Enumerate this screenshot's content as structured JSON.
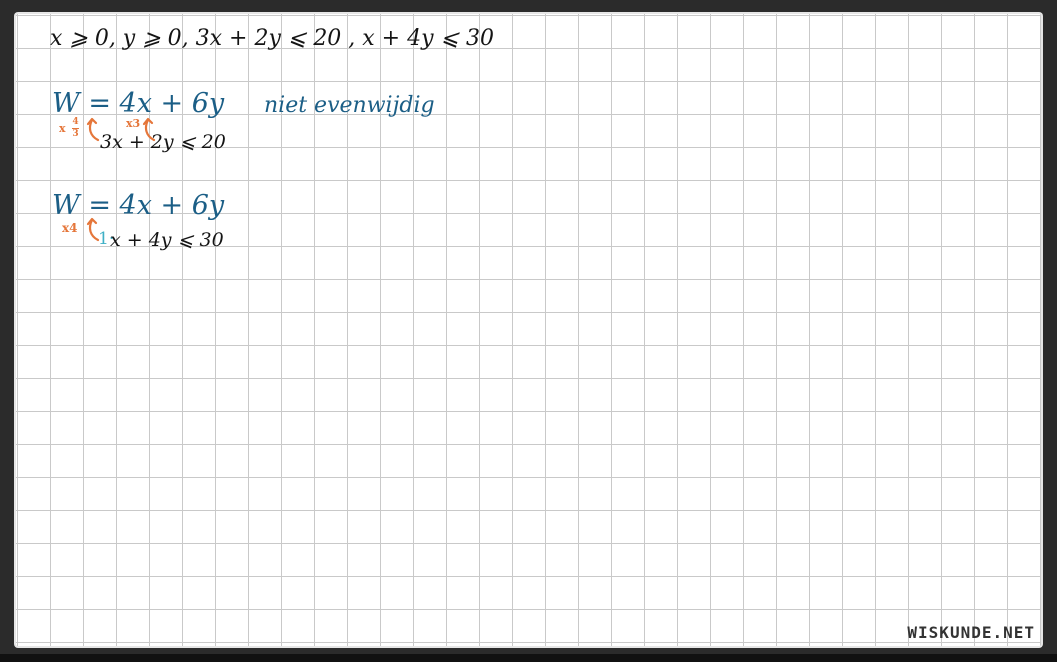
{
  "board": {
    "constraints": "x ⩾ 0,  y ⩾ 0,  3x + 2y ⩽ 20 ,  x + 4y ⩽ 30",
    "equation_1": {
      "objective": "W = 4x + 6y",
      "remark": "niet evenwijdig",
      "factor_a_label": "x",
      "factor_a_numerator": "4",
      "factor_a_denominator": "3",
      "factor_b_label": "x3",
      "constraint": "3x + 2y ⩽ 20"
    },
    "equation_2": {
      "objective": "W = 4x + 6y",
      "factor_a_label": "x4",
      "coefficient": "1·",
      "constraint": "x + 4y ⩽ 30"
    }
  },
  "watermark": "WISKUNDE.NET",
  "colors": {
    "ink_black": "#141414",
    "ink_blue": "#1b5e86",
    "ink_orange": "#e5763a",
    "ink_cyan": "#3fb0c6",
    "grid_line": "#c9c9c9"
  }
}
